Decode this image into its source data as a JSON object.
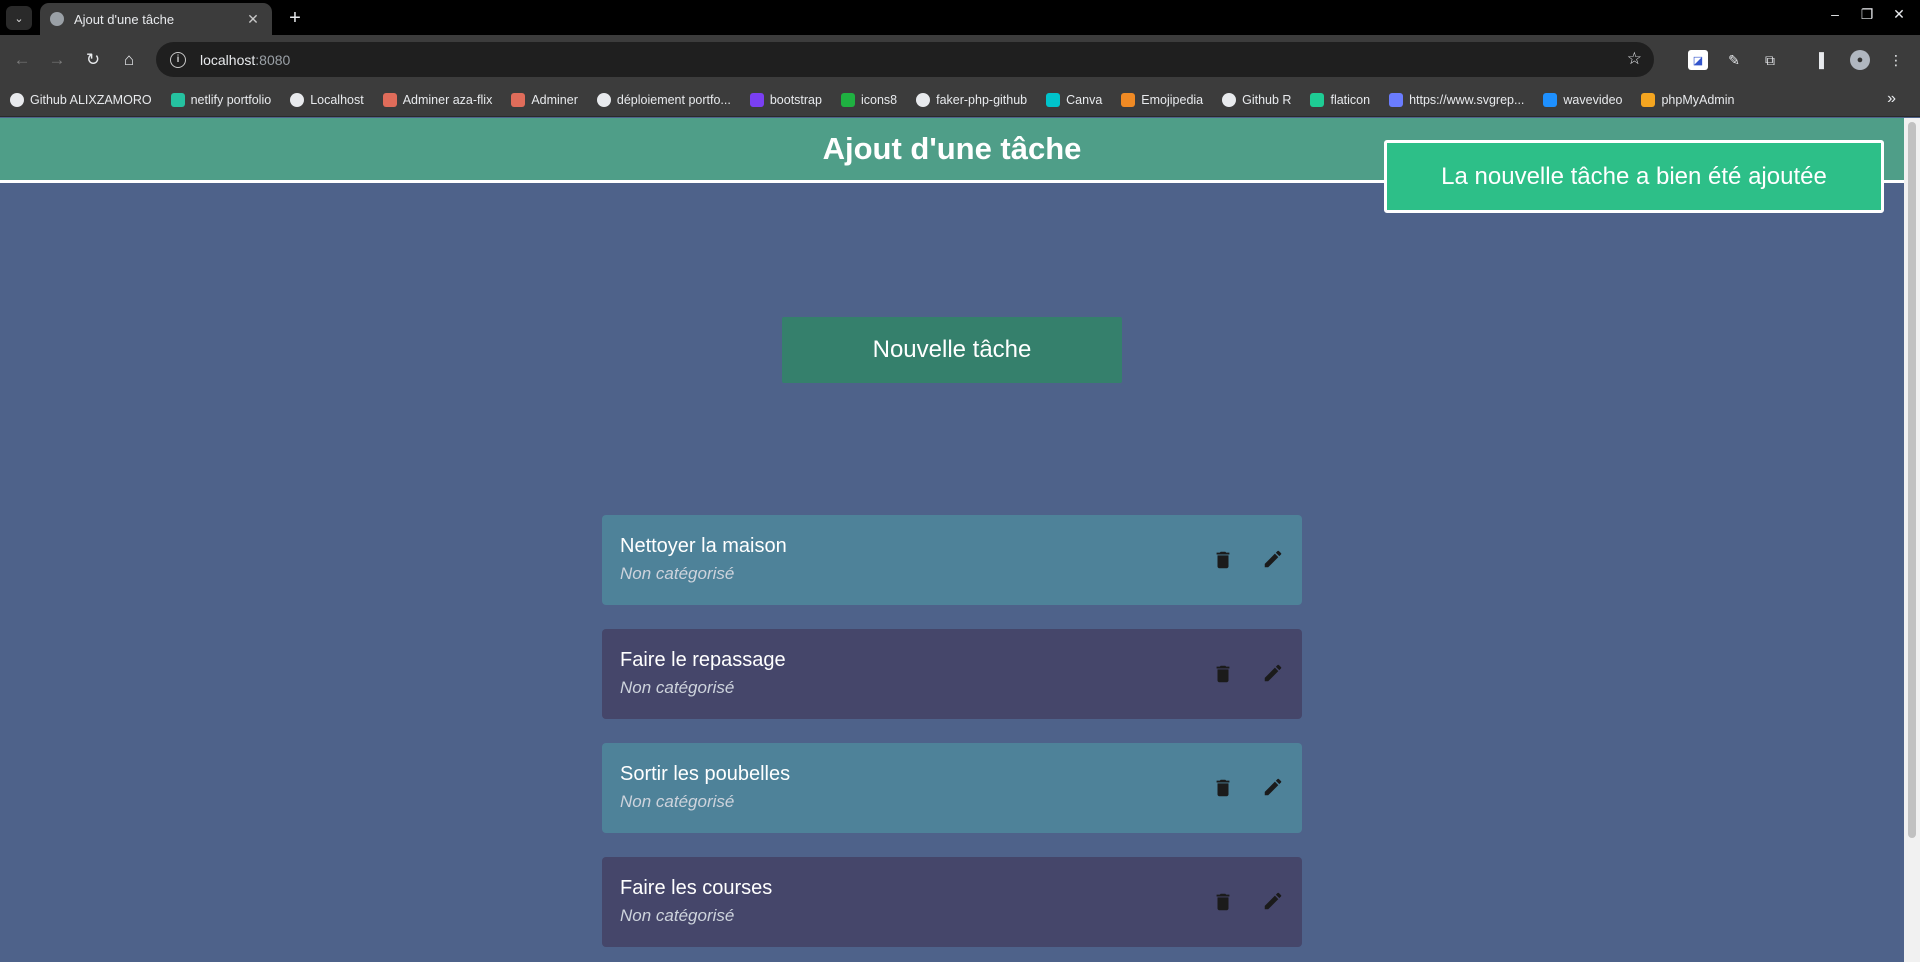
{
  "browser": {
    "tab_title": "Ajout d'une tâche",
    "url_host": "localhost",
    "url_port": ":8080",
    "bookmarks": [
      {
        "label": "Github ALIXZAMORO",
        "icon": "github-icon",
        "color": "#e8eaed"
      },
      {
        "label": "netlify portfolio",
        "icon": "netlify-icon",
        "color": "#25c2a0"
      },
      {
        "label": "Localhost",
        "icon": "globe-icon",
        "color": "#e8eaed"
      },
      {
        "label": "Adminer aza-flix",
        "icon": "adminer-icon",
        "color": "#e06c5a"
      },
      {
        "label": "Adminer",
        "icon": "adminer-icon",
        "color": "#e06c5a"
      },
      {
        "label": "déploiement portfo...",
        "icon": "github-icon",
        "color": "#e8eaed"
      },
      {
        "label": "bootstrap",
        "icon": "bootstrap-icon",
        "color": "#7a3ff2"
      },
      {
        "label": "icons8",
        "icon": "icons8-icon",
        "color": "#1fb141"
      },
      {
        "label": "faker-php-github",
        "icon": "faker-icon",
        "color": "#e8eaed"
      },
      {
        "label": "Canva",
        "icon": "canva-icon",
        "color": "#00c4cc"
      },
      {
        "label": "Emojipedia",
        "icon": "emojipedia-icon",
        "color": "#f08a24"
      },
      {
        "label": "Github R",
        "icon": "github-icon",
        "color": "#e8eaed"
      },
      {
        "label": "flaticon",
        "icon": "flaticon-icon",
        "color": "#1ecc94"
      },
      {
        "label": "https://www.svgrep...",
        "icon": "svgrepo-icon",
        "color": "#6a7cff"
      },
      {
        "label": "wavevideo",
        "icon": "wavevideo-icon",
        "color": "#1e90ff"
      },
      {
        "label": "phpMyAdmin",
        "icon": "phpmyadmin-icon",
        "color": "#f4a520"
      }
    ]
  },
  "header": {
    "title": "Ajout d'une tâche"
  },
  "toast": {
    "message": "La nouvelle tâche a bien été ajoutée"
  },
  "actions": {
    "new_task_label": "Nouvelle tâche"
  },
  "tasks": [
    {
      "name": "Nettoyer la maison",
      "category": "Non catégorisé"
    },
    {
      "name": "Faire le repassage",
      "category": "Non catégorisé"
    },
    {
      "name": "Sortir les poubelles",
      "category": "Non catégorisé"
    },
    {
      "name": "Faire les courses",
      "category": "Non catégorisé"
    }
  ],
  "colors": {
    "page_bg": "#4e628a",
    "header_bg": "#4f9e88",
    "toast_bg": "#2dbf88",
    "button_bg": "#35806c",
    "task_odd_bg": "#4e8299",
    "task_even_bg": "#45466a"
  }
}
